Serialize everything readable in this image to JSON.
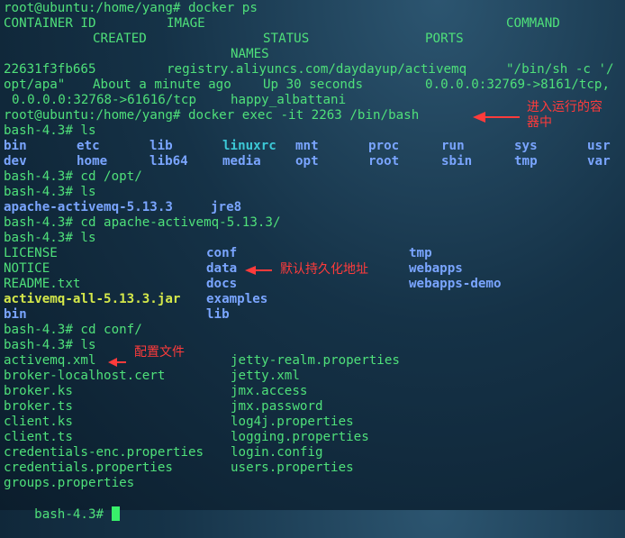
{
  "terminal": {
    "line1": "root@ubuntu:/home/yang# docker ps",
    "header": {
      "container_id": "CONTAINER ID",
      "image": "IMAGE",
      "command": "COMMAND",
      "created": "CREATED",
      "status": "STATUS",
      "ports": "PORTS",
      "names": "NAMES"
    },
    "container": {
      "id": "22631f3fb665",
      "image": "registry.aliyuncs.com/daydayup/activemq",
      "command_part1": "\"/bin/sh -c '/",
      "command_part2": "opt/apa\"",
      "created": "About a minute ago",
      "status": "Up 30 seconds",
      "ports1": "0.0.0.0:32769->8161/tcp,",
      "ports2": "0.0.0.0:32768->61616/tcp",
      "name": "happy_albattani"
    },
    "exec_line": "root@ubuntu:/home/yang# docker exec -it 2263 /bin/bash",
    "prompt_ls_1": "bash-4.3# ls",
    "root_dirs_row1": [
      "bin",
      "etc",
      "lib",
      "linuxrc",
      "mnt",
      "proc",
      "run",
      "sys",
      "usr"
    ],
    "root_dirs_row2": [
      "dev",
      "home",
      "lib64",
      "media",
      "opt",
      "root",
      "sbin",
      "tmp",
      "var"
    ],
    "cd_opt": "bash-4.3# cd /opt/",
    "prompt_ls_2": "bash-4.3# ls",
    "opt_items": [
      "apache-activemq-5.13.3",
      "jre8"
    ],
    "cd_amq": "bash-4.3# cd apache-activemq-5.13.3/",
    "prompt_ls_3": "bash-4.3# ls",
    "amq_col1": [
      "LICENSE",
      "NOTICE",
      "README.txt",
      "activemq-all-5.13.3.jar",
      "bin"
    ],
    "amq_col2": [
      "conf",
      "data",
      "docs",
      "examples",
      "lib"
    ],
    "amq_col3": [
      "tmp",
      "webapps",
      "webapps-demo"
    ],
    "cd_conf": "bash-4.3# cd conf/",
    "prompt_ls_4": "bash-4.3# ls",
    "conf_col1": [
      "activemq.xml",
      "broker-localhost.cert",
      "broker.ks",
      "broker.ts",
      "client.ks",
      "client.ts",
      "credentials-enc.properties",
      "credentials.properties",
      "groups.properties"
    ],
    "conf_col2": [
      "jetty-realm.properties",
      "jetty.xml",
      "jmx.access",
      "jmx.password",
      "log4j.properties",
      "logging.properties",
      "login.config",
      "users.properties"
    ],
    "final_prompt": "bash-4.3# "
  },
  "annotations": {
    "exec_note_line1": "进入运行的容",
    "exec_note_line2": "器中",
    "data_note": "默认持久化地址",
    "conf_note": "配置文件"
  },
  "colors": {
    "terminal_green": "#4fe07a",
    "directory_blue": "#7aa5ff",
    "symlink_cyan": "#3cc8d6",
    "annotation_red": "#ff3b3b",
    "background": "#153247"
  }
}
